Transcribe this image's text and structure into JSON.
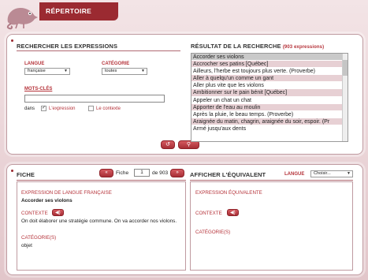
{
  "header": {
    "title": "RÉPERTOIRE"
  },
  "search": {
    "title": "RECHERCHER LES EXPRESSIONS",
    "langue_label": "LANGUE",
    "langue_value": "française",
    "categorie_label": "CATÉGORIE",
    "categorie_value": "toutes",
    "keywords_label": "MOTS-CLÉS",
    "keywords_value": "",
    "dans_label": "dans",
    "opt_expression": "L'expression",
    "opt_contexte": "Le contexte"
  },
  "results": {
    "title": "RÉSULTAT DE LA RECHERCHE",
    "count": "(903 expressions)",
    "items": [
      "Accorder ses violons",
      "Accrocher ses patins [Québec]",
      "Ailleurs, l'herbe est toujours plus verte. (Proverbe)",
      "Aller à quelqu'un comme un gant",
      "Aller plus vite que les violons",
      "Ambitionner sur le pain bénit [Québec]",
      "Appeler un chat un chat",
      "Apporter de l'eau au moulin",
      "Après la pluie, le beau temps. (Proverbe)",
      "Araignée du matin, chagrin, araignée du soir, espoir. (Pr",
      "Armé jusqu'aux dents"
    ]
  },
  "fiche": {
    "title": "FICHE",
    "label": "Fiche",
    "current": "1",
    "of_label": "de 903",
    "expr_heading": "EXPRESSION DE LANGUE FRANÇAISE",
    "expr_value": "Accorder ses violons",
    "contexte_label": "CONTEXTE",
    "contexte_text": "On doit élaborer une stratégie commune. On va accorder nos violons.",
    "categories_label": "CATÉGORIE(S)",
    "categories_value": "objet"
  },
  "equivalent": {
    "title": "AFFICHER L'ÉQUIVALENT",
    "langue_label": "LANGUE",
    "langue_value": "Choisir...",
    "expr_heading": "EXPRESSION ÉQUIVALENTE",
    "contexte_label": "CONTEXTE",
    "categories_label": "CATÉGORIE(S)"
  },
  "colors": {
    "accent": "#9b2a31",
    "label_red": "#b53239",
    "row_alt": "#e7d0d4",
    "row_selected": "#c9c9c9"
  }
}
